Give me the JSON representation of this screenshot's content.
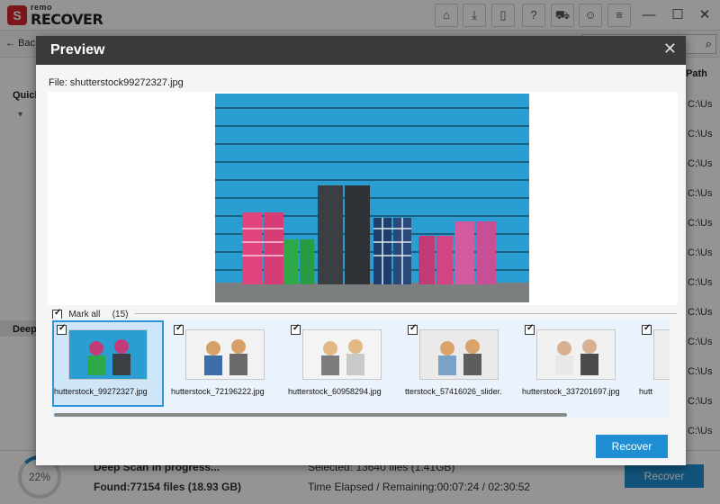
{
  "app": {
    "brand_small": "remo",
    "brand_big": "RECOVER",
    "logo_glyph": "S"
  },
  "titlebar": {
    "icons": [
      "home-icon",
      "download-icon",
      "file-icon",
      "help-icon",
      "cart-icon",
      "user-icon",
      "menu-icon"
    ],
    "window_controls": [
      "minimize-icon",
      "maximize-icon",
      "close-icon"
    ]
  },
  "background": {
    "back_label": "Bac",
    "sidebar": {
      "quick_label": "Quicl",
      "deep_label": "Deep"
    },
    "path_header": "Path",
    "path_cells": [
      "C:\\Us",
      "C:\\Us",
      "C:\\Us",
      "C:\\Us",
      "C:\\Us",
      "C:\\Us",
      "C:\\Us",
      "C:\\Us",
      "C:\\Us",
      "C:\\Us",
      "C:\\Us",
      "C:\\Us"
    ],
    "status": {
      "progress_percent": 22,
      "progress_label": "22%",
      "scan_text": "Deep Scan in progress...",
      "found_text": "Found:77154 files (18.93 GB)",
      "selected_text": "Selected: 13640 files (1.41GB)",
      "time_text": "Time Elapsed / Remaining:00:07:24 / 02:30:52",
      "recover_label": "Recover"
    }
  },
  "preview": {
    "title": "Preview",
    "file_label": "File:",
    "file_name": "shutterstock99272327.jpg",
    "mark_all_label": "Mark all",
    "count_label": "(15)",
    "thumbnails": [
      {
        "name": "hutterstock_99272327.jpg",
        "checked": true,
        "selected": true
      },
      {
        "name": "hutterstock_72196222.jpg",
        "checked": true,
        "selected": false
      },
      {
        "name": "hutterstock_60958294.jpg",
        "checked": true,
        "selected": false
      },
      {
        "name": "tterstock_57416026_slider.",
        "checked": true,
        "selected": false
      },
      {
        "name": "hutterstock_337201697.jpg",
        "checked": true,
        "selected": false
      },
      {
        "name": "hutt",
        "checked": true,
        "selected": false
      }
    ],
    "recover_label": "Recover"
  }
}
